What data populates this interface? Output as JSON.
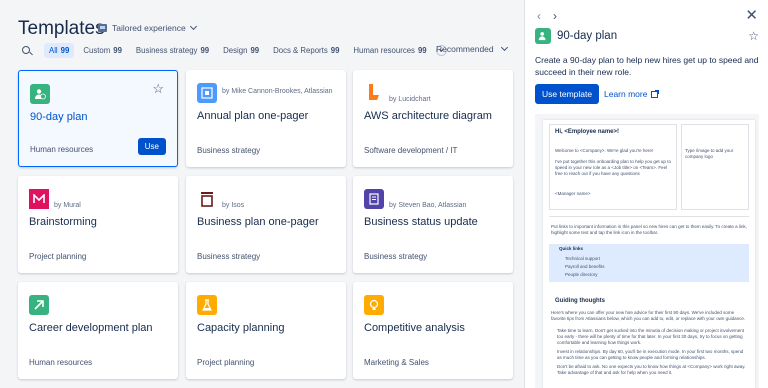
{
  "header": {
    "title": "Templates",
    "experience_label": "Tailored experience"
  },
  "filters": [
    {
      "label": "All",
      "count": "99",
      "active": true
    },
    {
      "label": "Custom",
      "count": "99"
    },
    {
      "label": "Business strategy",
      "count": "99"
    },
    {
      "label": "Design",
      "count": "99"
    },
    {
      "label": "Docs & Reports",
      "count": "99"
    },
    {
      "label": "Human resources",
      "count": "99"
    }
  ],
  "sort": {
    "label": "Recommended"
  },
  "cards": [
    {
      "name": "90-day plan",
      "by": "",
      "category": "Human resources",
      "use_label": "Use",
      "color": "#36b37e"
    },
    {
      "name": "Annual plan one-pager",
      "by": "by Mike Cannon-Brookes, Atlassian",
      "category": "Business strategy",
      "color": "#4c9aff"
    },
    {
      "name": "AWS architecture diagram",
      "by": "by Lucidchart",
      "category": "Software development / IT",
      "color": "#ff7a1a"
    },
    {
      "name": "Brainstorming",
      "by": "by Mural",
      "category": "Project planning",
      "color": "#e0115f"
    },
    {
      "name": "Business plan one-pager",
      "by": "by Isos",
      "category": "Business strategy",
      "color": "#6a1b1b"
    },
    {
      "name": "Business status update",
      "by": "by Steven Bao, Atlassian",
      "category": "Business strategy",
      "color": "#5243aa"
    },
    {
      "name": "Career development plan",
      "by": "",
      "category": "Human resources",
      "color": "#36b37e"
    },
    {
      "name": "Capacity planning",
      "by": "",
      "category": "Project planning",
      "color": "#ffab00"
    },
    {
      "name": "Competitive analysis",
      "by": "",
      "category": "Marketing & Sales",
      "color": "#ffab00"
    }
  ],
  "panel": {
    "title": "90-day plan",
    "description": "Create a 90-day plan to help new hires get up to speed and succeed in their new role.",
    "use_label": "Use template",
    "learn_label": "Learn more"
  },
  "preview": {
    "greeting": "Hi, <Employee name>!",
    "welcome": "Welcome to <Company>. We're glad you're here!",
    "body": "I've put together this onboarding plan to help you get up to speed in your new role as a <Job title> on <Team>. Feel free to reach out if you have any questions",
    "manager": "<Manager name>",
    "image_hint": "Type /image to add your company logo",
    "links_intro": "Put links to important information in this panel so new hires can get to them easily. To create a link, highlight some text and tap the link icon in the toolbar.",
    "quick_links": "Quick links",
    "links": [
      "Technical support",
      "Payroll and benefits",
      "People directory"
    ],
    "guiding": "Guiding thoughts",
    "guiding_intro": "Here's where you can offer your new hire advice for their first 90 days. We've included some favorite tips from Atlassians below, which you can add to, edit, or replace with your own guidance.",
    "tips": [
      "Take time to learn. Don't get sucked into the minutia of decision making or project involvement too early - there will be plenty of time for that later. In your first 30 days, try to focus on getting comfortable and learning how things work.",
      "Invest in relationships. By day 60, you'll be in execution mode. In your first two months, spend as much time as you can getting to know people and forming relationships.",
      "Don't be afraid to ask. No one expects you to know how things at <Company> work right away. Take advantage of that and ask for help when you need it."
    ]
  }
}
